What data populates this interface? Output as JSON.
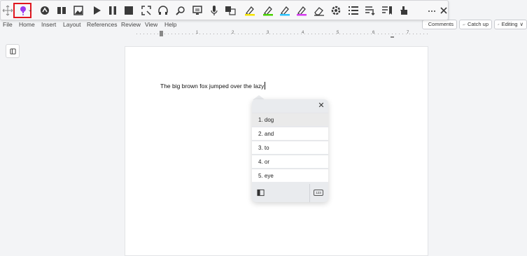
{
  "toolbar": {
    "icons": [
      "move-handle-icon",
      "highlighter-pen-icon",
      "chevron-down-icon",
      "immersive-reader-icon",
      "book-icon",
      "picture-icon",
      "play-icon",
      "pause-icon",
      "stop-icon",
      "screenshot-icon",
      "headphones-icon",
      "ink-icon",
      "screen-icon",
      "microphone-icon",
      "translate-icon",
      "highlighter-yellow-icon",
      "highlighter-green-icon",
      "highlighter-blue-icon",
      "highlighter-purple-icon",
      "eraser-icon",
      "settings-icon",
      "list-icon",
      "word-count-icon",
      "bookmark-icon",
      "hand-icon",
      "more-icon",
      "close-icon"
    ],
    "more_label": "···",
    "close_label": "✕"
  },
  "menu": [
    "File",
    "Home",
    "Insert",
    "Layout",
    "References",
    "Review",
    "View",
    "Help"
  ],
  "header_buttons": {
    "comments": "Comments",
    "catchup": "Catch up",
    "editing": "Editing"
  },
  "ruler": {
    "numbers": [
      "1",
      "2",
      "3",
      "4",
      "5",
      "6",
      "7"
    ]
  },
  "document": {
    "text": "The big brown fox jumped over the lazy"
  },
  "popup": {
    "suggestions": [
      "1. dog",
      "2. and",
      "3. to",
      "4. or",
      "5. eye"
    ],
    "selected_index": 0,
    "footer_right_label": "123"
  },
  "colors": {
    "highlight_box": "#e0161e",
    "accent_purple": "#9b3cf0",
    "page": "#ffffff"
  }
}
